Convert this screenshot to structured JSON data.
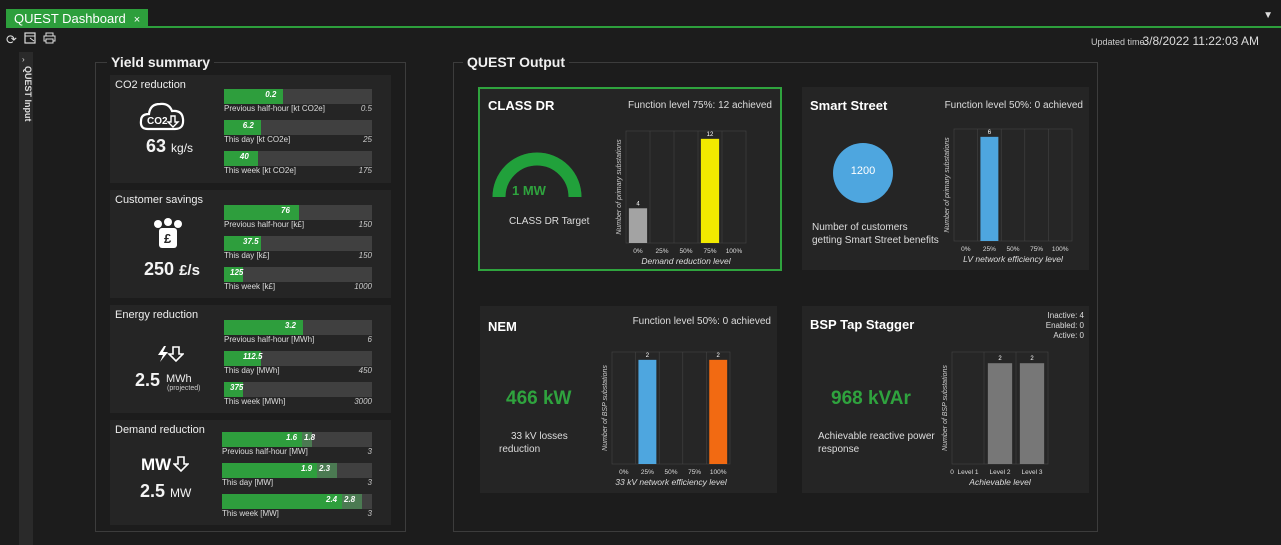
{
  "tab": {
    "label": "QUEST Dashboard",
    "close": "×"
  },
  "toolbar": {
    "updated_label": "Updated time:",
    "updated_value": "3/8/2022 11:22:03 AM"
  },
  "sidetab": {
    "label": "QUEST Input"
  },
  "yield": {
    "title": "Yield summary",
    "co2": {
      "title": "CO2 reduction",
      "icon_text": "CO2",
      "value": "63",
      "unit": "kg/s",
      "rows": [
        {
          "value": "0.2",
          "label": "Previous half-hour [kt CO2e]",
          "max": "0.5",
          "fraction": 0.4
        },
        {
          "value": "6.2",
          "label": "This day [kt CO2e]",
          "max": "25",
          "fraction": 0.248
        },
        {
          "value": "40",
          "label": "This week [kt CO2e]",
          "max": "175",
          "fraction": 0.229
        }
      ]
    },
    "customer": {
      "title": "Customer savings",
      "value": "250",
      "unit": "£/s",
      "rows": [
        {
          "value": "76",
          "label": "Previous half-hour [k£]",
          "max": "150",
          "fraction": 0.507
        },
        {
          "value": "37.5",
          "label": "This day [k£]",
          "max": "150",
          "fraction": 0.25
        },
        {
          "value": "125",
          "label": "This week [k£]",
          "max": "1000",
          "fraction": 0.125
        }
      ]
    },
    "energy": {
      "title": "Energy reduction",
      "value": "2.5",
      "unit": "MWh",
      "note": "(projected)",
      "rows": [
        {
          "value": "3.2",
          "label": "Previous half-hour [MWh]",
          "max": "6",
          "fraction": 0.533
        },
        {
          "value": "112.5",
          "label": "This day [MWh]",
          "max": "450",
          "fraction": 0.25
        },
        {
          "value": "375",
          "label": "This week [MWh]",
          "max": "3000",
          "fraction": 0.125
        }
      ]
    },
    "demand": {
      "title": "Demand reduction",
      "icon_text": "MW",
      "value": "2.5",
      "unit": "MW",
      "rows": [
        {
          "value": "1.6",
          "value2": "1.8",
          "label": "Previous half-hour [MW]",
          "max": "3",
          "fraction": 0.533,
          "fraction2": 0.6
        },
        {
          "value": "1.9",
          "value2": "2.3",
          "label": "This day [MW]",
          "max": "3",
          "fraction": 0.633,
          "fraction2": 0.767
        },
        {
          "value": "2.4",
          "value2": "2.8",
          "label": "This week [MW]",
          "max": "3",
          "fraction": 0.8,
          "fraction2": 0.933
        }
      ]
    }
  },
  "output": {
    "title": "QUEST Output",
    "classdr": {
      "title": "CLASS DR",
      "function": "Function level 75%: 12 achieved",
      "gauge_value": "1 MW",
      "gauge_fraction": 1.0,
      "gauge_label": "CLASS DR Target",
      "chart": {
        "type": "bar",
        "categories": [
          "0%",
          "25%",
          "50%",
          "75%",
          "100%"
        ],
        "values": [
          4,
          0,
          0,
          12,
          0
        ],
        "ylabel": "Number of primary substations",
        "xlabel": "Demand reduction level",
        "colors": [
          "#a3a3a3",
          "#888888",
          "#888888",
          "#f2ea00",
          "#888888"
        ]
      }
    },
    "smartstreet": {
      "title": "Smart Street",
      "function": "Function level 50%: 0 achieved",
      "circle_value": "1200",
      "label_line1": "Number of customers",
      "label_line2": "getting Smart Street benefits",
      "chart": {
        "type": "bar",
        "categories": [
          "0%",
          "25%",
          "50%",
          "75%",
          "100%"
        ],
        "values": [
          0,
          6,
          0,
          0,
          0
        ],
        "ylabel": "Number of primary substations",
        "xlabel": "LV network efficiency level",
        "colors": [
          "#4ea6df",
          "#4ea6df",
          "#4ea6df",
          "#4ea6df",
          "#4ea6df"
        ]
      }
    },
    "nem": {
      "title": "NEM",
      "function": "Function level 50%: 0 achieved",
      "value": "466 kW",
      "label_line1": "33 kV losses",
      "label_line2": "reduction",
      "chart": {
        "type": "bar",
        "categories": [
          "0%",
          "25%",
          "50%",
          "75%",
          "100%"
        ],
        "values": [
          0,
          2,
          0,
          0,
          2
        ],
        "ylabel": "Number of BSP substations",
        "xlabel": "33 kV network efficiency level",
        "colors": [
          "#888888",
          "#4ea6df",
          "#888888",
          "#888888",
          "#f26a12"
        ]
      }
    },
    "bsp": {
      "title": "BSP Tap Stagger",
      "status_inactive": "Inactive: 4",
      "status_enabled": "Enabled: 0",
      "status_active": "Active: 0",
      "value": "968 kVAr",
      "label_line1": "Achievable reactive power",
      "label_line2": "response",
      "chart": {
        "type": "bar",
        "categories": [
          "0",
          "Level 1",
          "Level 2",
          "Level 3"
        ],
        "values": [
          0,
          2,
          2
        ],
        "ylabel": "Number of BSP substations",
        "xlabel": "Achievable level",
        "colors": [
          "#777777",
          "#777777",
          "#777777"
        ]
      }
    }
  }
}
